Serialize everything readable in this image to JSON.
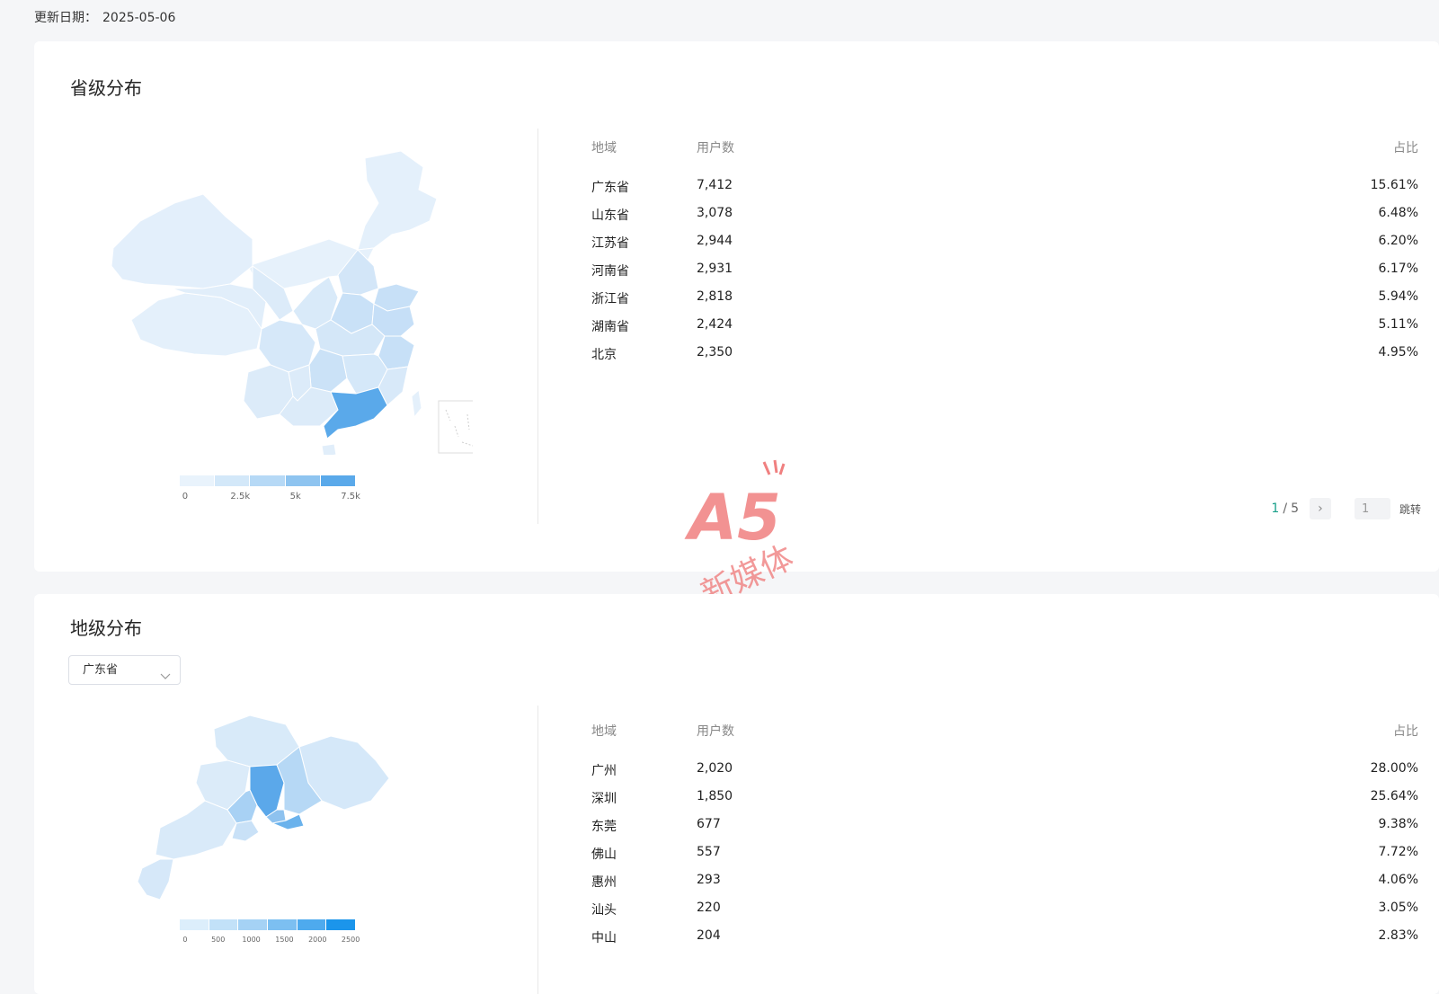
{
  "update": {
    "label": "更新日期：",
    "date": "2025-05-06"
  },
  "province": {
    "title": "省级分布",
    "legend": {
      "colors": [
        "#e9f3fc",
        "#d3e8f9",
        "#b6d9f6",
        "#8ec4f0",
        "#5aa9ea"
      ],
      "ticks": [
        "0",
        "2.5k",
        "5k",
        "7.5k"
      ]
    },
    "table": {
      "headers": {
        "region": "地域",
        "users": "用户数",
        "ratio": "占比"
      },
      "rows": [
        {
          "region": "广东省",
          "users": "7,412",
          "ratio": "15.61%"
        },
        {
          "region": "山东省",
          "users": "3,078",
          "ratio": "6.48%"
        },
        {
          "region": "江苏省",
          "users": "2,944",
          "ratio": "6.20%"
        },
        {
          "region": "河南省",
          "users": "2,931",
          "ratio": "6.17%"
        },
        {
          "region": "浙江省",
          "users": "2,818",
          "ratio": "5.94%"
        },
        {
          "region": "湖南省",
          "users": "2,424",
          "ratio": "5.11%"
        },
        {
          "region": "北京",
          "users": "2,350",
          "ratio": "4.95%"
        }
      ]
    },
    "pager": {
      "current": "1",
      "separator": "/",
      "total": "5",
      "input_value": "1",
      "jump_label": "跳转"
    }
  },
  "city": {
    "title": "地级分布",
    "select_value": "广东省",
    "legend": {
      "colors": [
        "#dceefb",
        "#c2e1f8",
        "#a5d2f5",
        "#7cbff1",
        "#4eaaee",
        "#1b95eb"
      ],
      "ticks": [
        "0",
        "500",
        "1000",
        "1500",
        "2000",
        "2500"
      ]
    },
    "table": {
      "headers": {
        "region": "地域",
        "users": "用户数",
        "ratio": "占比"
      },
      "rows": [
        {
          "region": "广州",
          "users": "2,020",
          "ratio": "28.00%"
        },
        {
          "region": "深圳",
          "users": "1,850",
          "ratio": "25.64%"
        },
        {
          "region": "东莞",
          "users": "677",
          "ratio": "9.38%"
        },
        {
          "region": "佛山",
          "users": "557",
          "ratio": "7.72%"
        },
        {
          "region": "惠州",
          "users": "293",
          "ratio": "4.06%"
        },
        {
          "region": "汕头",
          "users": "220",
          "ratio": "3.05%"
        },
        {
          "region": "中山",
          "users": "204",
          "ratio": "2.83%"
        }
      ]
    }
  },
  "watermark": {
    "logo_text": "A5",
    "text": "新媒体",
    "color": "#f07878"
  }
}
